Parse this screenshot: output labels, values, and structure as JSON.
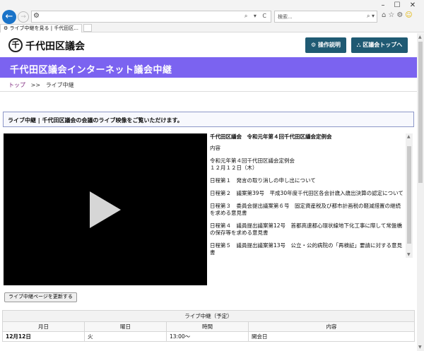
{
  "browser": {
    "window_controls": [
      "–",
      "☐",
      "✕"
    ],
    "back": "←",
    "forward": "→",
    "address_icon": "⚙",
    "address_tail": "⌕ ▾ C",
    "search_placeholder": "検索...",
    "search_tail": "⌕ ▾",
    "toolbar_icons": [
      "⌂",
      "☆",
      "⚙"
    ],
    "toolbar_smile": "☺",
    "tab_label": "ライブ中継を見る | 千代田区...",
    "tab_icon": "⚙"
  },
  "site": {
    "logo_char": "千",
    "name": "千代田区議会",
    "buttons": [
      {
        "icon": "⚙",
        "label": "操作説明"
      },
      {
        "icon": "⛬",
        "label": "区議会トップへ"
      }
    ],
    "banner_title": "千代田区議会インターネット議会中継",
    "breadcrumb": {
      "home": "トップ",
      "sep": ">>",
      "current": "ライブ中継"
    }
  },
  "notice": "ライブ中継 | 千代田区議会の会議のライブ映像をご覧いただけます。",
  "agenda": {
    "title": "千代田区議会　令和元年第４回千代田区議会定例会",
    "items": [
      "内容",
      "令和元年第４回千代田区議会定例会\n１２月１２日（木）",
      "日程第１　発言の取り消しの申し出について",
      "日程第２　議案第39号　平成30年度千代田区各会計歳入歳出決算の認定について",
      "日程第３　委員会提出議案第６号　固定資産税及び都市計画税の軽減措置の継続を求める意見書",
      "日程第４　議員提出議案第12号　首都高速都心環状線地下化工事に際して常盤橋の保存等を求める意見書",
      "日程第５　議員提出議案第13号　公立・公的病院の「再検証」要請に対する意見書"
    ]
  },
  "refresh_button": "ライブ中継ページを更新する",
  "schedule": {
    "caption": "ライブ中継（予定）",
    "headers": [
      "月日",
      "曜日",
      "時間",
      "内容"
    ],
    "rows": [
      [
        "12月12日",
        "火",
        "13:00～",
        "開会日"
      ]
    ]
  }
}
